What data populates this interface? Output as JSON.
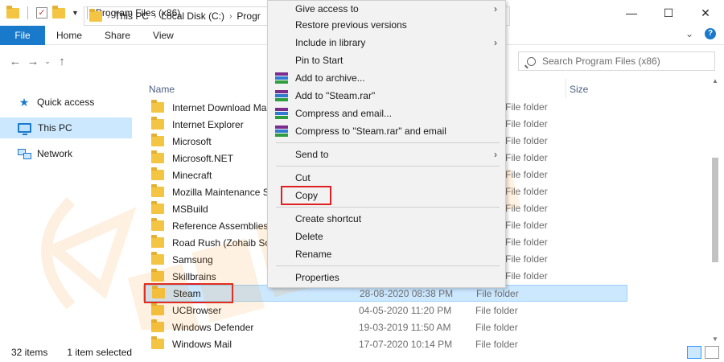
{
  "window": {
    "title": "Program Files (x86)"
  },
  "ribbon": {
    "file_tab": "File",
    "tabs": [
      "Home",
      "Share",
      "View"
    ]
  },
  "address": {
    "crumbs": [
      "This PC",
      "Local Disk (C:)",
      "Progr"
    ]
  },
  "search": {
    "placeholder": "Search Program Files (x86)"
  },
  "nav": {
    "items": [
      "Quick access",
      "This PC",
      "Network"
    ]
  },
  "columns": {
    "name": "Name",
    "size": "Size"
  },
  "files": [
    {
      "name": "Internet Download Man",
      "date": "",
      "type": ""
    },
    {
      "name": "Internet Explorer",
      "date": "",
      "type": ""
    },
    {
      "name": "Microsoft",
      "date": "",
      "type": ""
    },
    {
      "name": "Microsoft.NET",
      "date": "",
      "type": ""
    },
    {
      "name": "Minecraft",
      "date": "",
      "type": ""
    },
    {
      "name": "Mozilla Maintenance Se",
      "date": "",
      "type": ""
    },
    {
      "name": "MSBuild",
      "date": "",
      "type": ""
    },
    {
      "name": "Reference Assemblies",
      "date": "",
      "type": ""
    },
    {
      "name": "Road Rush (Zohaib Soft",
      "date": "",
      "type": ""
    },
    {
      "name": "Samsung",
      "date": "",
      "type": ""
    },
    {
      "name": "Skillbrains",
      "date": "",
      "type": ""
    },
    {
      "name": "Steam",
      "date": "28-08-2020 08:38 PM",
      "type": "File folder"
    },
    {
      "name": "UCBrowser",
      "date": "04-05-2020 11:20 PM",
      "type": "File folder"
    },
    {
      "name": "Windows Defender",
      "date": "19-03-2019 11:50 AM",
      "type": "File folder"
    },
    {
      "name": "Windows Mail",
      "date": "17-07-2020 10:14 PM",
      "type": "File folder"
    }
  ],
  "ghost_types": "File folder",
  "status": {
    "count": "32 items",
    "selected": "1 item selected"
  },
  "context_menu": {
    "give_access": "Give access to",
    "restore": "Restore previous versions",
    "include_library": "Include in library",
    "pin_start": "Pin to Start",
    "add_archive": "Add to archive...",
    "add_rar": "Add to \"Steam.rar\"",
    "compress_email": "Compress and email...",
    "compress_rar_email": "Compress to \"Steam.rar\" and email",
    "send_to": "Send to",
    "cut": "Cut",
    "copy": "Copy",
    "create_shortcut": "Create shortcut",
    "delete": "Delete",
    "rename": "Rename",
    "properties": "Properties"
  },
  "colors": {
    "accent": "#1979ca",
    "selection": "#cce8ff",
    "highlight_box": "#e02020",
    "watermark": "#f7931e"
  }
}
